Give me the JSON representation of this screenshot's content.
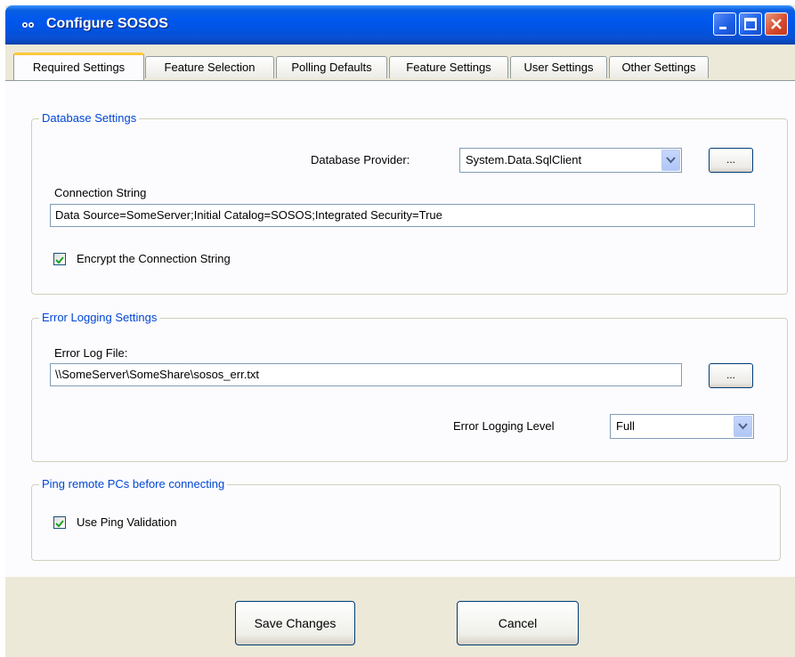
{
  "window": {
    "title": "Configure SOSOS"
  },
  "tabs": [
    {
      "label": "Required Settings",
      "active": true
    },
    {
      "label": "Feature Selection",
      "active": false
    },
    {
      "label": "Polling Defaults",
      "active": false
    },
    {
      "label": "Feature Settings",
      "active": false
    },
    {
      "label": "User Settings",
      "active": false
    },
    {
      "label": "Other Settings",
      "active": false
    }
  ],
  "database": {
    "group_title": "Database Settings",
    "provider_label": "Database Provider:",
    "provider_value": "System.Data.SqlClient",
    "browse_label": "...",
    "connection_label": "Connection String",
    "connection_value": "Data Source=SomeServer;Initial Catalog=SOSOS;Integrated Security=True",
    "encrypt_label": "Encrypt the Connection String",
    "encrypt_checked": true
  },
  "error_logging": {
    "group_title": "Error Logging Settings",
    "file_label": "Error Log File:",
    "file_value": "\\\\SomeServer\\SomeShare\\sosos_err.txt",
    "browse_label": "...",
    "level_label": "Error Logging Level",
    "level_value": "Full"
  },
  "ping": {
    "group_title": "Ping remote PCs before connecting",
    "validation_label": "Use Ping Validation",
    "validation_checked": true
  },
  "footer": {
    "save_label": "Save Changes",
    "cancel_label": "Cancel"
  },
  "colors": {
    "titlebar": "#0054e3",
    "group_title": "#0046d5",
    "tab_highlight": "#ffc83c",
    "dialog_bg": "#ece9d8"
  }
}
